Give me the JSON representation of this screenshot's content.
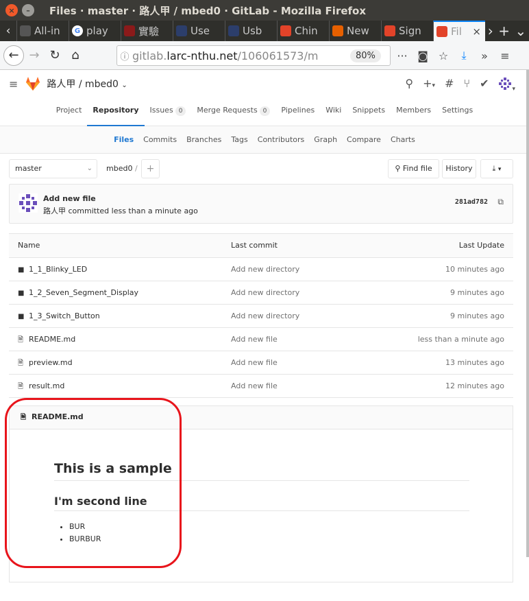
{
  "window": {
    "title": "Files · master · 路人甲 / mbed0 · GitLab - Mozilla Firefox"
  },
  "browser": {
    "tabs": [
      {
        "label": "All-in",
        "icon": "window-icon",
        "color": "#555"
      },
      {
        "label": "play",
        "icon": "google-icon",
        "color": "#fff"
      },
      {
        "label": "實驗",
        "icon": "book-icon",
        "color": "#8b1a1a"
      },
      {
        "label": "Use",
        "icon": "doc-icon",
        "color": "#2c3e6b"
      },
      {
        "label": "Usb",
        "icon": "doc-icon",
        "color": "#2c3e6b"
      },
      {
        "label": "Chin",
        "icon": "gitlab-icon",
        "color": "#e24329"
      },
      {
        "label": "New",
        "icon": "firefox-icon",
        "color": "#e66000"
      },
      {
        "label": "Sign",
        "icon": "gitlab-icon",
        "color": "#e24329"
      },
      {
        "label": "Fil",
        "icon": "gitlab-icon",
        "color": "#e24329",
        "active": true
      }
    ],
    "url_host": "gitlab.",
    "url_domain": "larc-nthu.net",
    "url_path": "/106061573/m",
    "zoom": "80%"
  },
  "header": {
    "project": "路人甲 / mbed0"
  },
  "project_tabs": [
    {
      "label": "Project"
    },
    {
      "label": "Repository",
      "active": true
    },
    {
      "label": "Issues",
      "count": "0"
    },
    {
      "label": "Merge Requests",
      "count": "0"
    },
    {
      "label": "Pipelines"
    },
    {
      "label": "Wiki"
    },
    {
      "label": "Snippets"
    },
    {
      "label": "Members"
    },
    {
      "label": "Settings"
    }
  ],
  "sub_tabs": [
    {
      "label": "Files",
      "active": true
    },
    {
      "label": "Commits"
    },
    {
      "label": "Branches"
    },
    {
      "label": "Tags"
    },
    {
      "label": "Contributors"
    },
    {
      "label": "Graph"
    },
    {
      "label": "Compare"
    },
    {
      "label": "Charts"
    }
  ],
  "controls": {
    "branch": "master",
    "path": "mbed0",
    "separator": "/",
    "find_file": "Find file",
    "history": "History"
  },
  "last_commit": {
    "title": "Add new file",
    "meta": "路人甲 committed less than a minute ago",
    "sha": "281ad782"
  },
  "table": {
    "headers": {
      "name": "Name",
      "commit": "Last commit",
      "update": "Last Update"
    },
    "rows": [
      {
        "type": "folder",
        "name": "1_1_Blinky_LED",
        "commit": "Add new directory",
        "update": "10 minutes ago"
      },
      {
        "type": "folder",
        "name": "1_2_Seven_Segment_Display",
        "commit": "Add new directory",
        "update": "9 minutes ago"
      },
      {
        "type": "folder",
        "name": "1_3_Switch_Button",
        "commit": "Add new directory",
        "update": "9 minutes ago"
      },
      {
        "type": "file",
        "name": "README.md",
        "commit": "Add new file",
        "update": "less than a minute ago"
      },
      {
        "type": "file",
        "name": "preview.md",
        "commit": "Add new file",
        "update": "13 minutes ago"
      },
      {
        "type": "file",
        "name": "result.md",
        "commit": "Add new file",
        "update": "12 minutes ago"
      }
    ]
  },
  "readme": {
    "filename": "README.md",
    "h1": "This is a sample",
    "h2": "I'm second line",
    "items": [
      "BUR",
      "BURBUR"
    ]
  },
  "colors": {
    "accent": "#1f78d1",
    "highlight": "#e8141b",
    "gitlab": "#e24329"
  }
}
